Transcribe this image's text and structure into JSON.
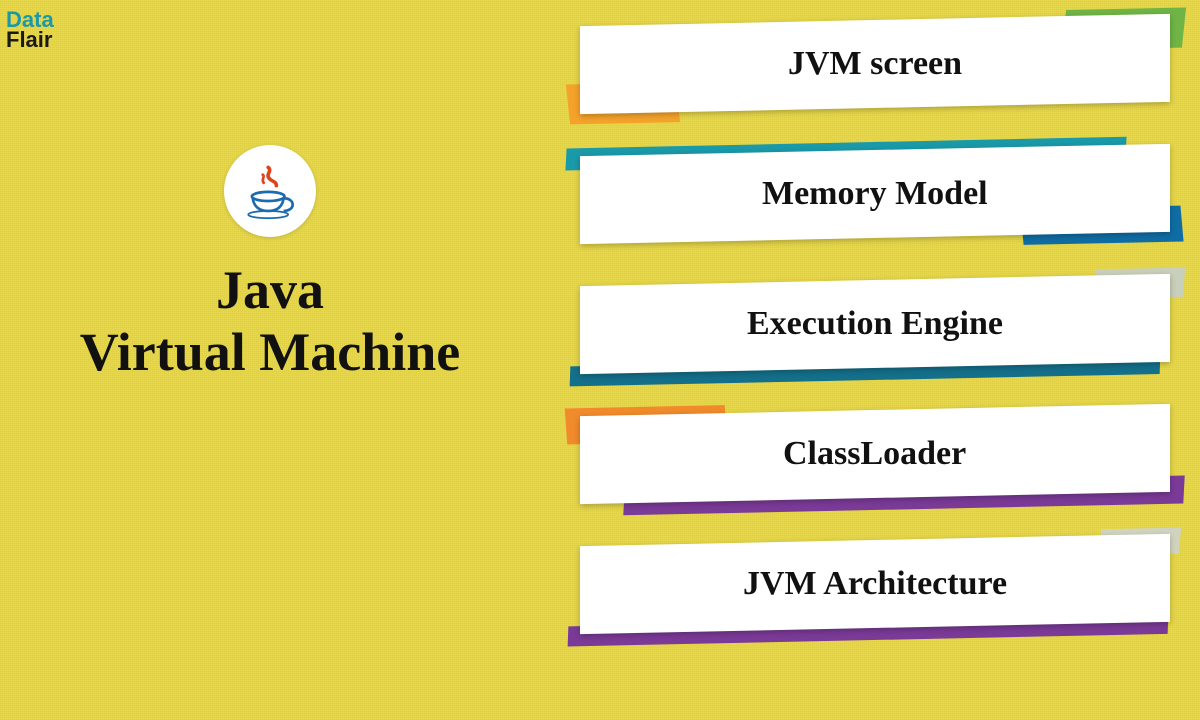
{
  "brand": {
    "line1": "Data",
    "line2": "Flair"
  },
  "title": {
    "line1": "Java",
    "line2": "Virtual Machine"
  },
  "cards": [
    {
      "label": "JVM screen",
      "accent": "a1"
    },
    {
      "label": "Memory Model",
      "accent": "a2"
    },
    {
      "label": "Execution Engine",
      "accent": "a3"
    },
    {
      "label": "ClassLoader",
      "accent": "a4"
    },
    {
      "label": "JVM Architecture",
      "accent": "a5"
    }
  ],
  "colors": {
    "background": "#e8d84a",
    "teal": "#1a99a8",
    "orange": "#f4a22a",
    "green": "#6fb445",
    "purple": "#7a3a97",
    "blue": "#0f6da3"
  }
}
